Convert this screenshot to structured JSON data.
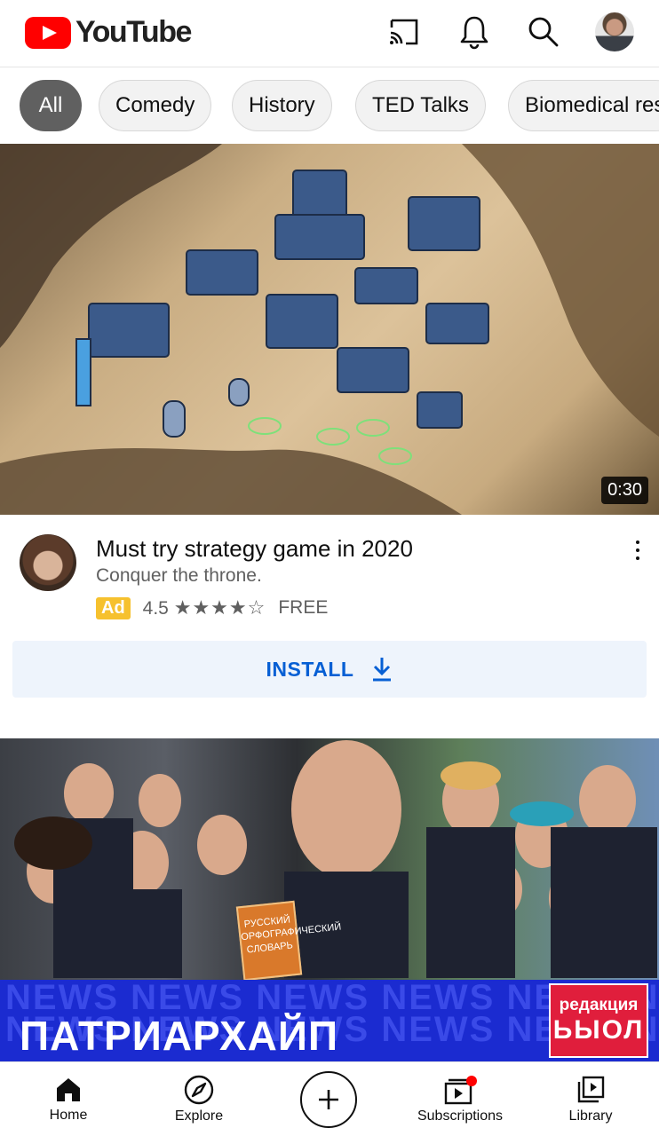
{
  "header": {
    "logo_text": "YouTube",
    "icons": [
      "cast-icon",
      "notifications-bell-icon",
      "search-icon",
      "account-avatar"
    ]
  },
  "chips": [
    {
      "label": "All",
      "active": true
    },
    {
      "label": "Comedy",
      "active": false
    },
    {
      "label": "History",
      "active": false
    },
    {
      "label": "TED Talks",
      "active": false
    },
    {
      "label": "Biomedical res",
      "active": false
    }
  ],
  "ad": {
    "duration": "0:30",
    "title": "Must try strategy game in 2020",
    "subtitle": "Conquer the throne.",
    "badge": "Ad",
    "rating": "4.5",
    "stars_text": "★★★★☆",
    "price": "FREE",
    "install_label": "INSTALL"
  },
  "news_video": {
    "band_text": "NEWS NEWS NEWS NEWS NEWS NEWS",
    "title_overlay": "ПАТРИАРХАЙП",
    "brand_top": "редакция",
    "brand_bottom": "ЬЫОЛ",
    "book_text": "РУССКИЙ ОРФОГРАФИЧЕСКИЙ СЛОВАРЬ"
  },
  "bottom_nav": [
    {
      "label": "Home",
      "icon": "home-icon"
    },
    {
      "label": "Explore",
      "icon": "compass-icon"
    },
    {
      "label": "",
      "icon": "create-plus-icon"
    },
    {
      "label": "Subscriptions",
      "icon": "subscriptions-icon"
    },
    {
      "label": "Library",
      "icon": "library-icon"
    }
  ],
  "colors": {
    "brand_red": "#ff0000",
    "link_blue": "#065fd4",
    "ad_badge": "#f6c12e",
    "news_blue": "#1b2bd0"
  }
}
